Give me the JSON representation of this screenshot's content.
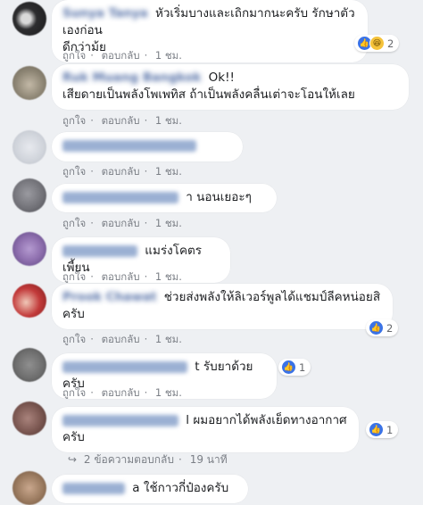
{
  "comments": [
    {
      "name": "Sunya Tanya",
      "text_line1": "หัวเริ่มบางและเถิกมากนะครับ รักษาตัวเองก่อน",
      "text_line2": "ดีกว่าม้ย",
      "reactions": "2"
    },
    {
      "name": "Ruk Muang Bangkok",
      "text_line1": "Ok!!",
      "text_line2": "เสียดายเป็นพลังโพเพทิส ถ้าเป็นพลังคลื่นเต่าจะโอนให้เลย"
    },
    {
      "name": "",
      "text_line1": ""
    },
    {
      "name": "",
      "text_line1": "า นอนเยอะๆ"
    },
    {
      "name": "",
      "text_line1": "แมร่งโคตรเพี้ยน"
    },
    {
      "name": "Prook Chawat",
      "text_line1": "ช่วยส่งพลังให้ลิเวอร์พูลได้แชมป์ลีคหน่อยสิ",
      "text_line2": "ครับ",
      "reactions": "2"
    },
    {
      "name": "",
      "text_line1": "t รับยาด้วยครับ",
      "reactions": "1"
    },
    {
      "name": "",
      "text_line1": "l ผมอยากได้พลังเย็ดทางอากาศครับ",
      "reactions": "1"
    },
    {
      "name": "",
      "text_line1": "a ใช้กาวกี่ป๋องครับ"
    }
  ],
  "actions": {
    "like": "ถูกใจ",
    "reply": "ตอบกลับ",
    "time": "1 ชม."
  },
  "replies": {
    "label": "2 ข้อความตอบกลับ",
    "time": "19 นาที"
  }
}
